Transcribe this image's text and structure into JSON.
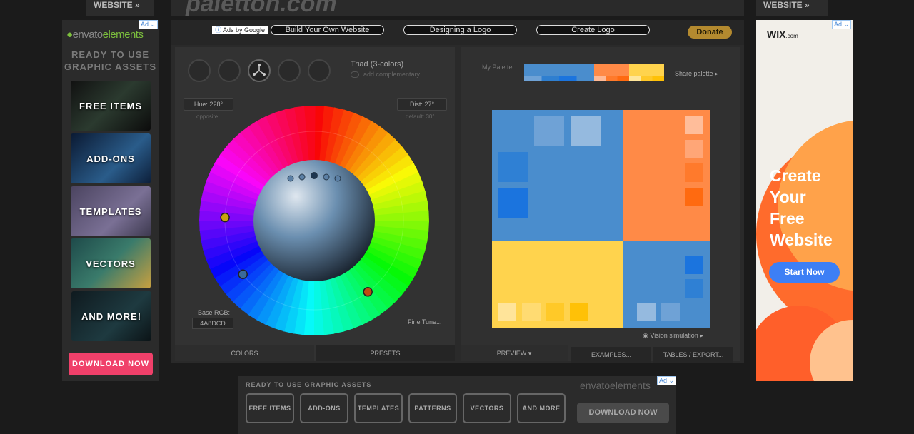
{
  "top": {
    "left_tab": "WEBSITE »",
    "right_tab": "WEBSITE »",
    "logo_text": "paletton.com"
  },
  "left_ad": {
    "badge": "Ad",
    "brand_prefix": "envato",
    "brand_suffix": "elements",
    "headline_line1": "READY TO USE",
    "headline_line2": "GRAPHIC ASSETS",
    "tiles": [
      "FREE ITEMS",
      "ADD-ONS",
      "TEMPLATES",
      "VECTORS",
      "AND MORE!"
    ],
    "download": "DOWNLOAD NOW"
  },
  "ads_bar": {
    "ads_by": "Ads by Google",
    "links": [
      "Build Your Own Website",
      "Designing a Logo",
      "Create Logo"
    ],
    "donate": "Donate"
  },
  "scheme": {
    "icons": [
      "mono-icon",
      "adjacent-icon",
      "triad-icon",
      "tetrad-icon",
      "free-style-icon"
    ],
    "title": "Triad (3-colors)",
    "add_complementary": "add complementary"
  },
  "wheel": {
    "hue_label": "Hue: 228°",
    "hue_sub": "opposite",
    "dist_label": "Dist: 27°",
    "dist_sub": "default: 30°",
    "base_rgb_label": "Base RGB:",
    "base_rgb_value": "4A8DCD",
    "fine_tune": "Fine Tune..."
  },
  "left_tabs": [
    "COLORS",
    "PRESETS"
  ],
  "palette": {
    "label": "My Palette:",
    "share": "Share palette",
    "vision": "Vision simulation",
    "colors": {
      "primary": "#4a8dcd",
      "secondary": "#ff8a47",
      "tertiary": "#ffd34d"
    }
  },
  "right_tabs": [
    "PREVIEW",
    "EXAMPLES...",
    "TABLES / EXPORT..."
  ],
  "right_ad": {
    "badge": "Ad",
    "brand": "WIX",
    "brand_suffix": ".com",
    "headline_line1": "Create",
    "headline_line2": "Your",
    "headline_line3": "Free",
    "headline_line4": "Website",
    "cta": "Start Now"
  },
  "bottom_ad": {
    "badge": "Ad",
    "headline": "READY TO USE GRAPHIC ASSETS",
    "brand": "envatoelements",
    "categories": [
      "FREE ITEMS",
      "ADD-ONS",
      "TEMPLATES",
      "PATTERNS",
      "VECTORS",
      "AND MORE"
    ],
    "download": "DOWNLOAD NOW"
  }
}
